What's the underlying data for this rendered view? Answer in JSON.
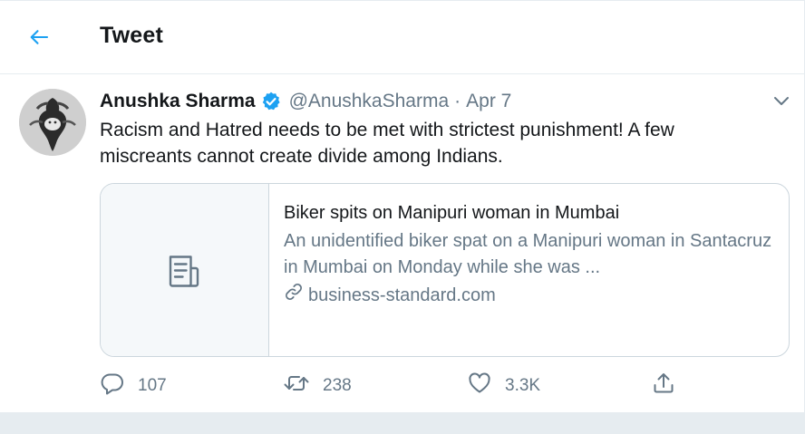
{
  "colors": {
    "accent": "#1da1f2",
    "text_primary": "#14171a",
    "text_secondary": "#657786",
    "border": "#ccd6dd",
    "card_thumb_bg": "#f5f8fa"
  },
  "header": {
    "back_icon": "arrow-left-icon",
    "title": "Tweet"
  },
  "tweet": {
    "author_name": "Anushka Sharma",
    "verified_icon": "verified-badge-icon",
    "handle": "@AnushkaSharma",
    "separator": "·",
    "date": "Apr 7",
    "menu_icon": "chevron-down-icon",
    "text": "Racism and Hatred needs to be met with strictest punishment! A few miscreants cannot create divide among Indians.",
    "card": {
      "thumb_icon": "article-icon",
      "title": "Biker spits on Manipuri woman in Mumbai",
      "description": "An unidentified biker spat on a Manipuri woman in Santacruz in Mumbai on Monday while she was ...",
      "link_icon": "link-icon",
      "domain": "business-standard.com"
    },
    "actions": {
      "reply": {
        "icon": "reply-icon",
        "count": "107"
      },
      "retweet": {
        "icon": "retweet-icon",
        "count": "238"
      },
      "like": {
        "icon": "heart-icon",
        "count": "3.3K"
      },
      "share": {
        "icon": "share-icon"
      }
    }
  }
}
